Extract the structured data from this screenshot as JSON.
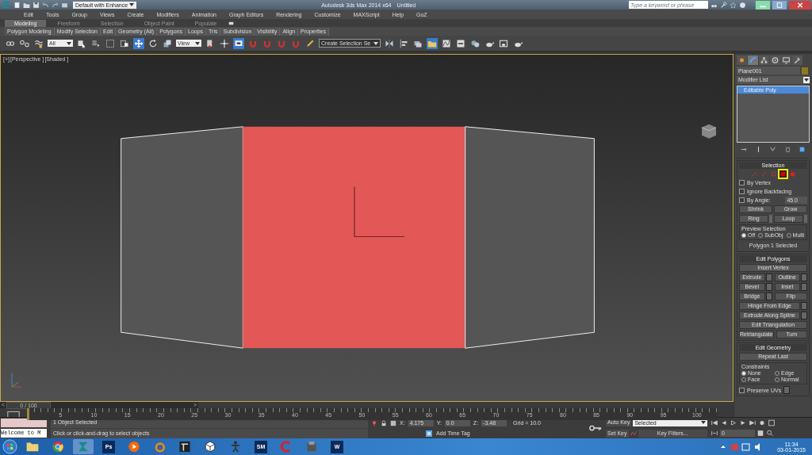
{
  "title_bar": {
    "workspace": "Default with Enhance",
    "app_title": "Autodesk 3ds Max 2014 x64",
    "document": "Untitled",
    "search": {
      "placeholder": "Type a keyword or phrase"
    }
  },
  "menu": [
    "Edit",
    "Tools",
    "Group",
    "Views",
    "Create",
    "Modifiers",
    "Animation",
    "Graph Editors",
    "Rendering",
    "Customize",
    "MAXScript",
    "Help",
    "GoZ"
  ],
  "ribbon_tabs": [
    {
      "label": "Modeling",
      "selected": true
    },
    {
      "label": "Freeform",
      "selected": false
    },
    {
      "label": "Selection",
      "selected": false
    },
    {
      "label": "Object Paint",
      "selected": false
    },
    {
      "label": "Populate",
      "selected": false
    }
  ],
  "ribbon_panels": [
    "Polygon Modeling",
    "Modify Selection",
    "Edit",
    "Geometry (All)",
    "Polygons",
    "Loops",
    "Tris",
    "Subdivision",
    "Visibility",
    "Align",
    "Properties"
  ],
  "toolbar": [
    {
      "kind": "link",
      "selected": false
    },
    {
      "kind": "unlink",
      "selected": false
    },
    {
      "kind": "bind",
      "selected": false
    },
    {
      "kind": "dropdown",
      "value": "All"
    },
    {
      "kind": "select",
      "selected": false
    },
    {
      "kind": "list",
      "selected": false
    },
    {
      "kind": "region",
      "selected": false
    },
    {
      "kind": "crossing",
      "selected": false
    },
    {
      "kind": "move",
      "selected": true
    },
    {
      "kind": "rotate",
      "selected": false
    },
    {
      "kind": "scale",
      "selected": false
    },
    {
      "kind": "dropdown",
      "value": "View"
    },
    {
      "kind": "pivot",
      "selected": false
    },
    {
      "kind": "crosshair",
      "selected": false
    },
    {
      "kind": "monitor",
      "selected": true
    },
    {
      "kind": "snap",
      "selected": false
    },
    {
      "kind": "snap",
      "selected": false
    },
    {
      "kind": "snap",
      "selected": false
    },
    {
      "kind": "snap",
      "selected": false
    },
    {
      "kind": "pencil",
      "selected": false
    },
    {
      "kind": "dropdown",
      "value": "Create Selection Se"
    },
    {
      "kind": "mirror",
      "selected": false
    },
    {
      "kind": "align",
      "selected": false
    },
    {
      "kind": "layers",
      "selected": false
    },
    {
      "kind": "folder",
      "selected": true
    },
    {
      "kind": "curve",
      "selected": false
    },
    {
      "kind": "schematic",
      "selected": false
    },
    {
      "kind": "spheres",
      "selected": false
    },
    {
      "kind": "teapot",
      "selected": false
    },
    {
      "kind": "frame",
      "selected": false
    },
    {
      "kind": "teapot",
      "selected": false
    }
  ],
  "viewport": {
    "labels": [
      "[+]",
      "[Perspective ]",
      "[Shaded ]"
    ],
    "planes": [
      {
        "selected": false
      },
      {
        "selected": true
      },
      {
        "selected": false
      }
    ]
  },
  "command_panel": {
    "tabs": [
      {
        "kind": "create",
        "selected": false
      },
      {
        "kind": "modify",
        "selected": true
      },
      {
        "kind": "hierarchy",
        "selected": false
      },
      {
        "kind": "motion",
        "selected": false
      },
      {
        "kind": "display",
        "selected": false
      },
      {
        "kind": "utilities",
        "selected": false
      }
    ],
    "object_name": "Plane001",
    "modifier_list": "Modifier List",
    "modifier_stack": [
      {
        "label": "Editable Poly",
        "selected": true
      }
    ],
    "selection": {
      "title": "Selection",
      "levels": [
        {
          "kind": "vertex",
          "selected": false
        },
        {
          "kind": "edge",
          "selected": false
        },
        {
          "kind": "border",
          "selected": false
        },
        {
          "kind": "polygon",
          "selected": true
        },
        {
          "kind": "element",
          "selected": false
        }
      ],
      "options": [
        {
          "label": "By Vertex",
          "checked": false
        },
        {
          "label": "Ignore Backfacing",
          "checked": false
        },
        {
          "label": "By Angle:",
          "checked": false,
          "value": "45.0"
        }
      ],
      "buttons": [
        {
          "label": "Shrink",
          "spinner": false
        },
        {
          "label": "Grow",
          "spinner": false
        },
        {
          "label": "Ring",
          "spinner": true
        },
        {
          "label": "Loop",
          "spinner": true
        }
      ],
      "preview": {
        "label": "Preview Selection",
        "options": [
          {
            "label": "Off",
            "selected": true
          },
          {
            "label": "SubObj",
            "selected": false
          },
          {
            "label": "Multi",
            "selected": false
          }
        ]
      },
      "status": "Polygon 1 Selected"
    },
    "edit_polygons": {
      "title": "Edit Polygons",
      "rows": [
        [
          {
            "label": "Insert Vertex",
            "settings": false
          }
        ],
        [
          {
            "label": "Extrude",
            "settings": true
          },
          {
            "label": "Outline",
            "settings": true
          }
        ],
        [
          {
            "label": "Bevel",
            "settings": true
          },
          {
            "label": "Inset",
            "settings": true
          }
        ],
        [
          {
            "label": "Bridge",
            "settings": true
          },
          {
            "label": "Flip",
            "settings": false
          }
        ],
        [
          {
            "label": "Hinge From Edge",
            "settings": true
          }
        ],
        [
          {
            "label": "Extrude Along Spline",
            "settings": true
          }
        ],
        [
          {
            "label": "Edit Triangulation",
            "settings": false
          }
        ],
        [
          {
            "label": "Retriangulate",
            "settings": false
          },
          {
            "label": "Turn",
            "settings": false
          }
        ]
      ]
    },
    "edit_geometry": {
      "title": "Edit Geometry",
      "repeat": "Repeat Last",
      "constraints": {
        "label": "Constraints",
        "options": [
          {
            "label": "None",
            "selected": true
          },
          {
            "label": "Edge",
            "selected": false
          },
          {
            "label": "Face",
            "selected": false
          },
          {
            "label": "Normal",
            "selected": false
          }
        ]
      },
      "preserve_uvs": {
        "label": "Preserve UVs",
        "checked": false
      }
    }
  },
  "time_slider": {
    "position": "0 / 100",
    "prev": "<",
    "next": ">",
    "level": 0
  },
  "ruler": [
    "5",
    "10",
    "15",
    "20",
    "25",
    "30",
    "35",
    "40",
    "45",
    "50",
    "55",
    "60",
    "65",
    "70",
    "75",
    "80",
    "85",
    "90",
    "95",
    "100"
  ],
  "status_bar": {
    "listener": "Welcome to M",
    "selection": "1 Object Selected",
    "prompt": "Click or click-and-drag to select objects",
    "coordinates": [
      {
        "label": "X:",
        "value": "4.175"
      },
      {
        "label": "Y:",
        "value": "0.0"
      },
      {
        "label": "Z:",
        "value": "-3.48"
      }
    ],
    "grid": "Grid = 10.0",
    "time_tag": "Add Time Tag",
    "auto_key": "Auto Key",
    "set_key": "Set Key",
    "key_mode": "Selected",
    "key_filters": "Key Filters...",
    "frame": "0"
  },
  "taskbar": {
    "apps": [
      {
        "kind": "folder",
        "active": false
      },
      {
        "kind": "globe",
        "active": false
      },
      {
        "kind": "max",
        "active": true
      },
      {
        "kind": "tile",
        "label": "Ps",
        "active": false
      },
      {
        "kind": "media",
        "active": false
      },
      {
        "kind": "blender",
        "active": false
      },
      {
        "kind": "dark",
        "active": false
      },
      {
        "kind": "cube",
        "active": false
      },
      {
        "kind": "figure",
        "active": false
      },
      {
        "kind": "tile",
        "label": "SM",
        "active": false
      },
      {
        "kind": "broom",
        "active": false
      },
      {
        "kind": "installer",
        "active": false
      },
      {
        "kind": "tile",
        "label": "W",
        "active": false
      }
    ],
    "time": "11:34",
    "date": "03-01-2015"
  }
}
